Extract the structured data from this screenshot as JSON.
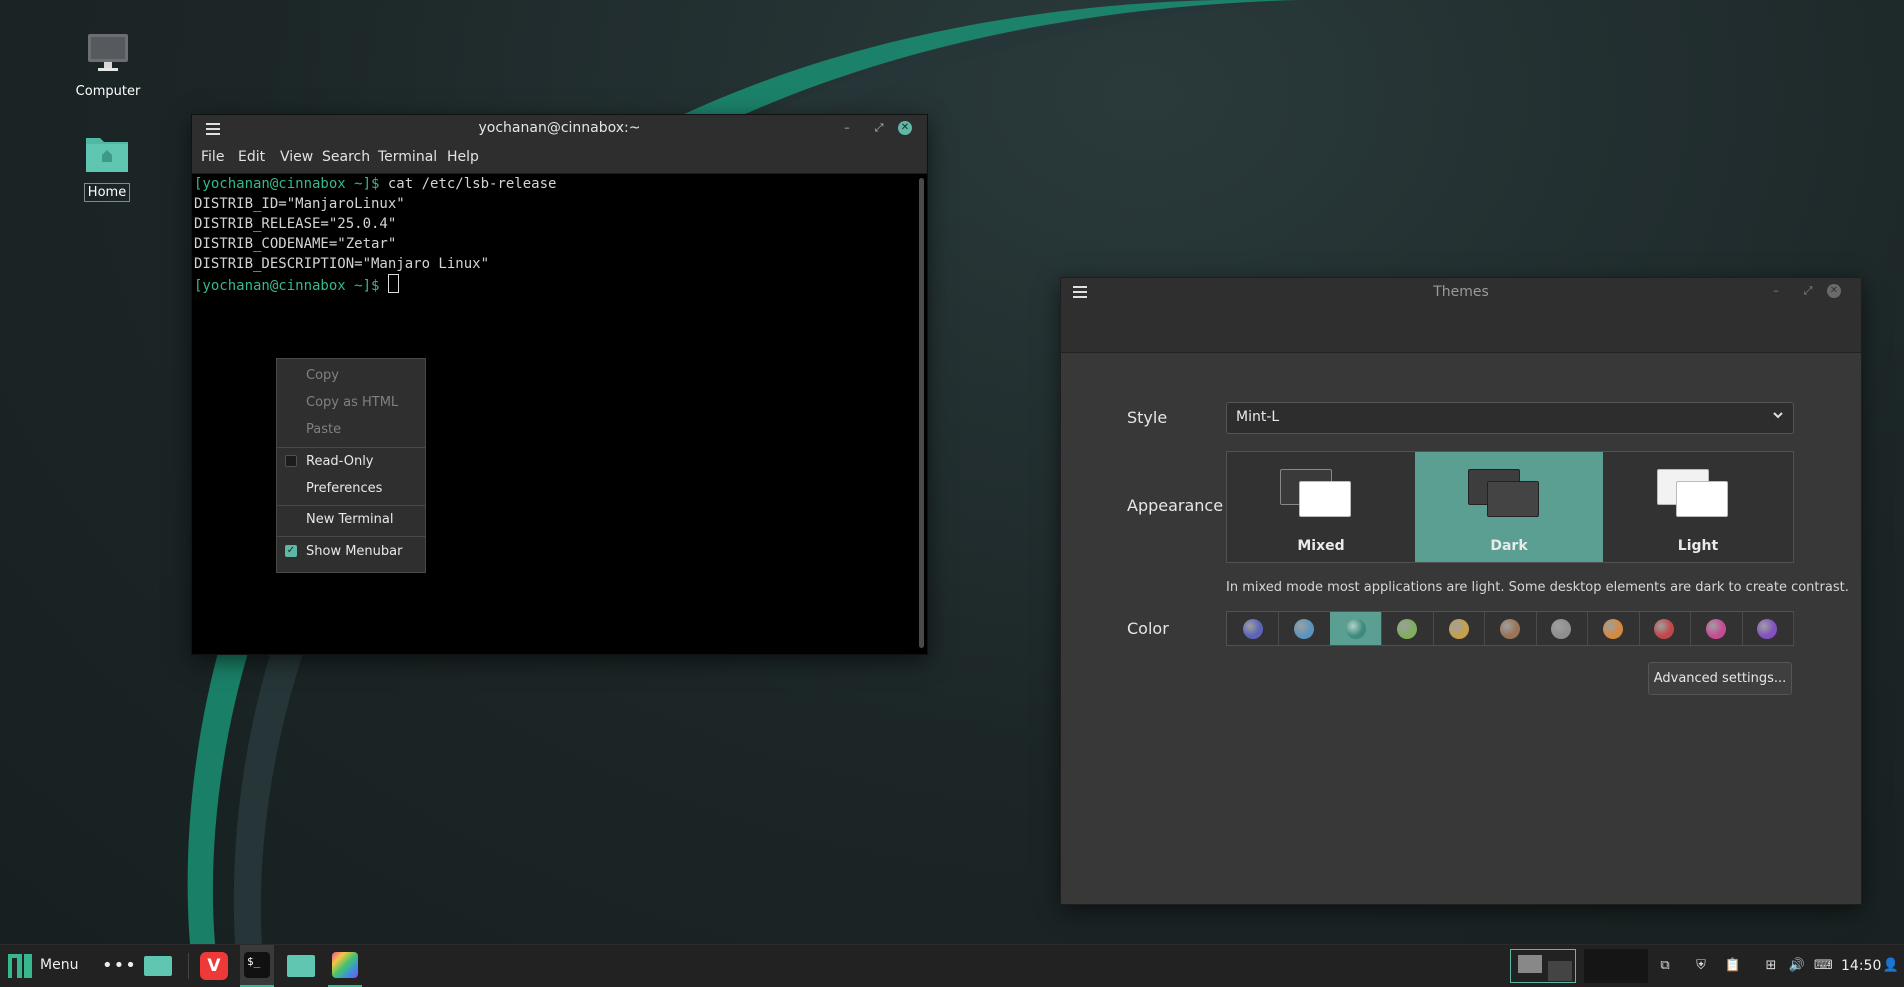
{
  "desktop": {
    "icons": [
      {
        "label": "Computer"
      },
      {
        "label": "Home"
      }
    ]
  },
  "terminal": {
    "title": "yochanan@cinnabox:~",
    "menu": [
      "File",
      "Edit",
      "View",
      "Search",
      "Terminal",
      "Help"
    ],
    "lines": [
      {
        "prompt": "[yochanan@cinnabox ~]$",
        "text": " cat /etc/lsb-release"
      },
      {
        "prompt": "",
        "text": "DISTRIB_ID=\"ManjaroLinux\""
      },
      {
        "prompt": "",
        "text": "DISTRIB_RELEASE=\"25.0.4\""
      },
      {
        "prompt": "",
        "text": "DISTRIB_CODENAME=\"Zetar\""
      },
      {
        "prompt": "",
        "text": "DISTRIB_DESCRIPTION=\"Manjaro Linux\""
      },
      {
        "prompt": "[yochanan@cinnabox ~]$",
        "text": " "
      }
    ]
  },
  "context_menu": {
    "copy": "Copy",
    "copy_html": "Copy as HTML",
    "paste": "Paste",
    "read_only": "Read-Only",
    "read_only_checked": false,
    "preferences": "Preferences",
    "new_terminal": "New Terminal",
    "show_menubar": "Show Menubar",
    "show_menubar_checked": true
  },
  "themes": {
    "title": "Themes",
    "style_label": "Style",
    "style_value": "Mint-L",
    "appearance_label": "Appearance",
    "appearance_options": [
      "Mixed",
      "Dark",
      "Light"
    ],
    "appearance_selected": "Dark",
    "mode_note": "In mixed mode most applications are light. Some desktop elements are dark to create contrast.",
    "color_label": "Color",
    "colors": [
      "#5b64b8",
      "#5a95c0",
      "#3f8a7c",
      "#7fae5e",
      "#c5a04c",
      "#9a7459",
      "#8f8f8f",
      "#d48a3e",
      "#c1474a",
      "#c54b95",
      "#8451c0"
    ],
    "color_selected_index": 2,
    "advanced_button": "Advanced settings..."
  },
  "taskbar": {
    "menu_label": "Menu",
    "clock": "14:50",
    "accent": "#35b88f"
  }
}
